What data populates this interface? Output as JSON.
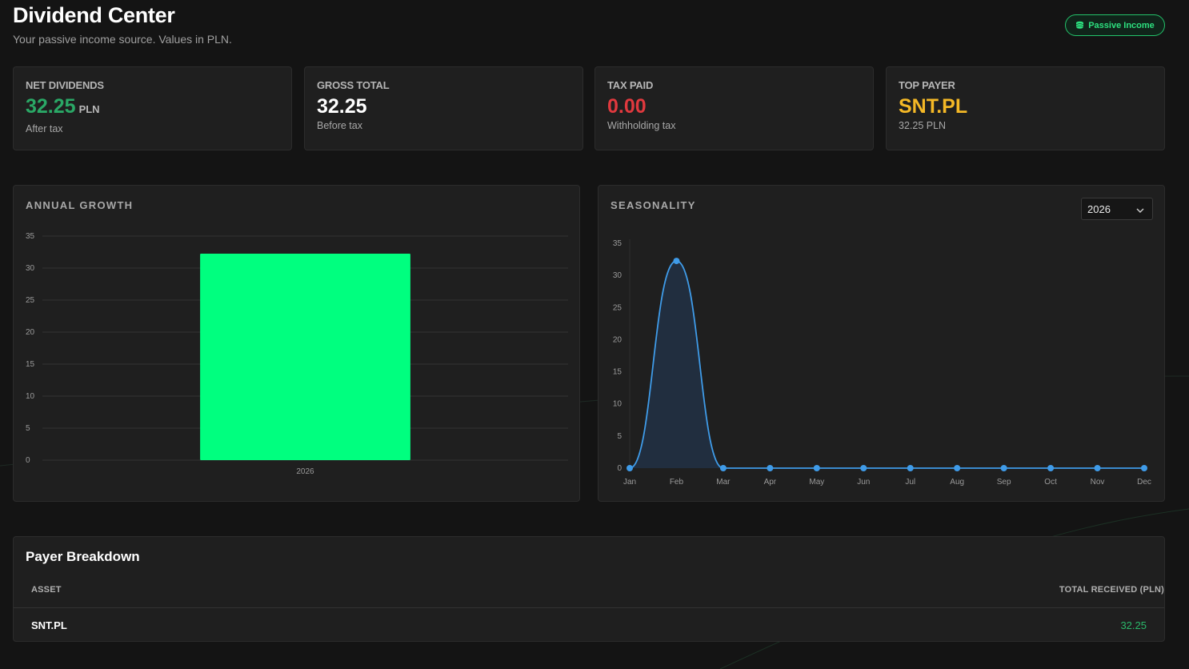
{
  "header": {
    "title": "Dividend Center",
    "subtitle": "Your passive income source. Values in PLN."
  },
  "badge": {
    "label": "Passive Income",
    "icon": "coins-icon",
    "color": "#2de07f"
  },
  "stats": [
    {
      "label": "NET DIVIDENDS",
      "value": "32.25",
      "unit": "PLN",
      "note": "After tax",
      "color": "#2aa866"
    },
    {
      "label": "GROSS TOTAL",
      "value": "32.25",
      "unit": "",
      "note": "Before tax",
      "color": "#ffffff"
    },
    {
      "label": "TAX PAID",
      "value": "0.00",
      "unit": "",
      "note": "Withholding tax",
      "color": "#e0393e"
    },
    {
      "label": "TOP PAYER",
      "value": "SNT.PL",
      "unit": "",
      "note": "32.25 PLN",
      "color": "#f4b826"
    }
  ],
  "annual_chart": {
    "title": "ANNUAL GROWTH"
  },
  "seasonality_chart": {
    "title": "SEASONALITY",
    "year_select": {
      "selected": "2026",
      "icon": "chevron-down-icon"
    }
  },
  "chart_data": [
    {
      "type": "bar",
      "title": "ANNUAL GROWTH",
      "categories": [
        "2026"
      ],
      "values": [
        32.25
      ],
      "ylim": [
        0,
        35
      ],
      "yticks": [
        0,
        5,
        10,
        15,
        20,
        25,
        30,
        35
      ],
      "grid": true,
      "color": "#00ff7f"
    },
    {
      "type": "area",
      "title": "SEASONALITY",
      "categories": [
        "Jan",
        "Feb",
        "Mar",
        "Apr",
        "May",
        "Jun",
        "Jul",
        "Aug",
        "Sep",
        "Oct",
        "Nov",
        "Dec"
      ],
      "values": [
        0,
        32.25,
        0,
        0,
        0,
        0,
        0,
        0,
        0,
        0,
        0,
        0
      ],
      "ylim": [
        0,
        35
      ],
      "yticks": [
        0,
        5,
        10,
        15,
        20,
        25,
        30,
        35
      ],
      "grid": false,
      "color": "#3f9be8"
    }
  ],
  "payer_table": {
    "title": "Payer Breakdown",
    "columns": [
      "ASSET",
      "TOTAL RECEIVED (PLN)"
    ],
    "rows": [
      {
        "asset": "SNT.PL",
        "total": "32.25"
      }
    ]
  }
}
